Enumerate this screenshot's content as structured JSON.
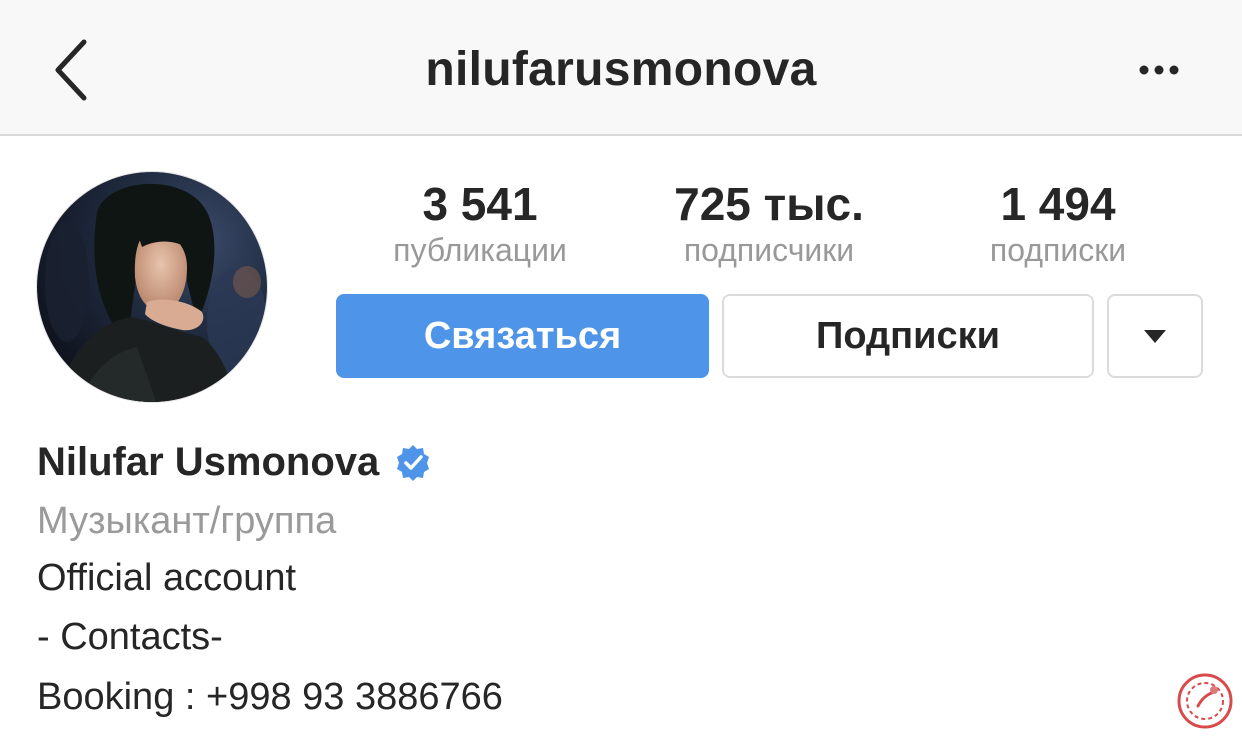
{
  "header": {
    "username": "nilufarusmonova",
    "back_icon": "chevron-left-icon",
    "more_icon": "more-horizontal-icon"
  },
  "profile": {
    "avatar_icon": "avatar",
    "stats": {
      "posts_count": "3 541",
      "posts_label": "публикации",
      "followers_count": "725 тыс.",
      "followers_label": "подписчики",
      "following_count": "1 494",
      "following_label": "подписки"
    },
    "actions": {
      "contact_label": "Связаться",
      "following_label": "Подписки",
      "dropdown_icon": "caret-down-icon"
    }
  },
  "bio": {
    "name": "Nilufar Usmonova",
    "verified_icon": "verified-badge-icon",
    "category": "Музыкант/группа",
    "lines": [
      "Official account",
      "- Contacts-",
      "Booking : +998 93 3886766"
    ]
  },
  "colors": {
    "accent": "#4e95ea",
    "text": "#262626",
    "secondary_text": "#999999",
    "header_bg": "#f8f8f8",
    "border": "#dbdbdb"
  }
}
